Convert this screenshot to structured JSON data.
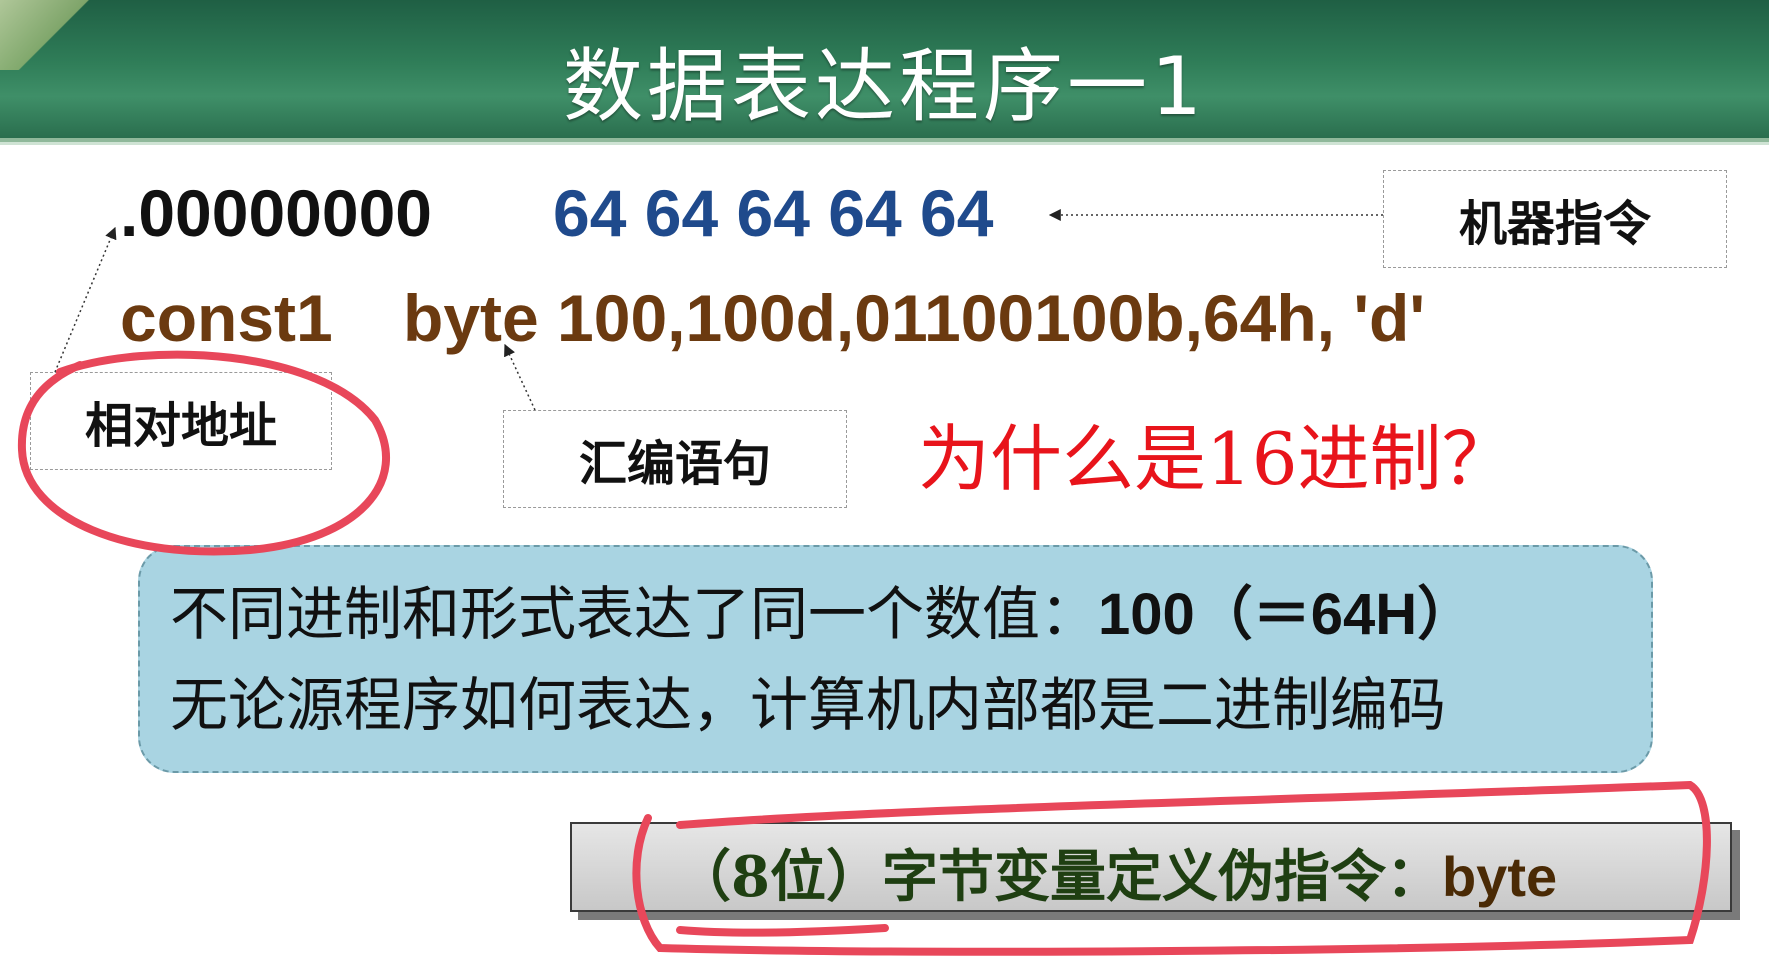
{
  "header": {
    "title": "数据表达程序一1"
  },
  "code": {
    "address": ".00000000",
    "machine_code": "64 64 64 64 64",
    "label": "const1",
    "statement": "byte 100,100d,01100100b,64h, 'd'"
  },
  "annotations": {
    "machine_instruction": "机器指令",
    "relative_address": "相对地址",
    "assembly_statement": "汇编语句",
    "question": "为什么是16进制？"
  },
  "info": {
    "line1_text": "不同进制和形式表达了同一个数值：",
    "line1_value": "100（＝64H）",
    "line2": "无论源程序如何表达，计算机内部都是二进制编码"
  },
  "footer": {
    "text": "（8位）字节变量定义伪指令：",
    "keyword": "byte"
  },
  "colors": {
    "header_green": "#2f7d58",
    "machine_code_blue": "#1f4a8c",
    "statement_brown": "#6b3a10",
    "question_red": "#e8141b",
    "info_bg": "#a9d4e2",
    "ink_red": "#e8475a"
  }
}
